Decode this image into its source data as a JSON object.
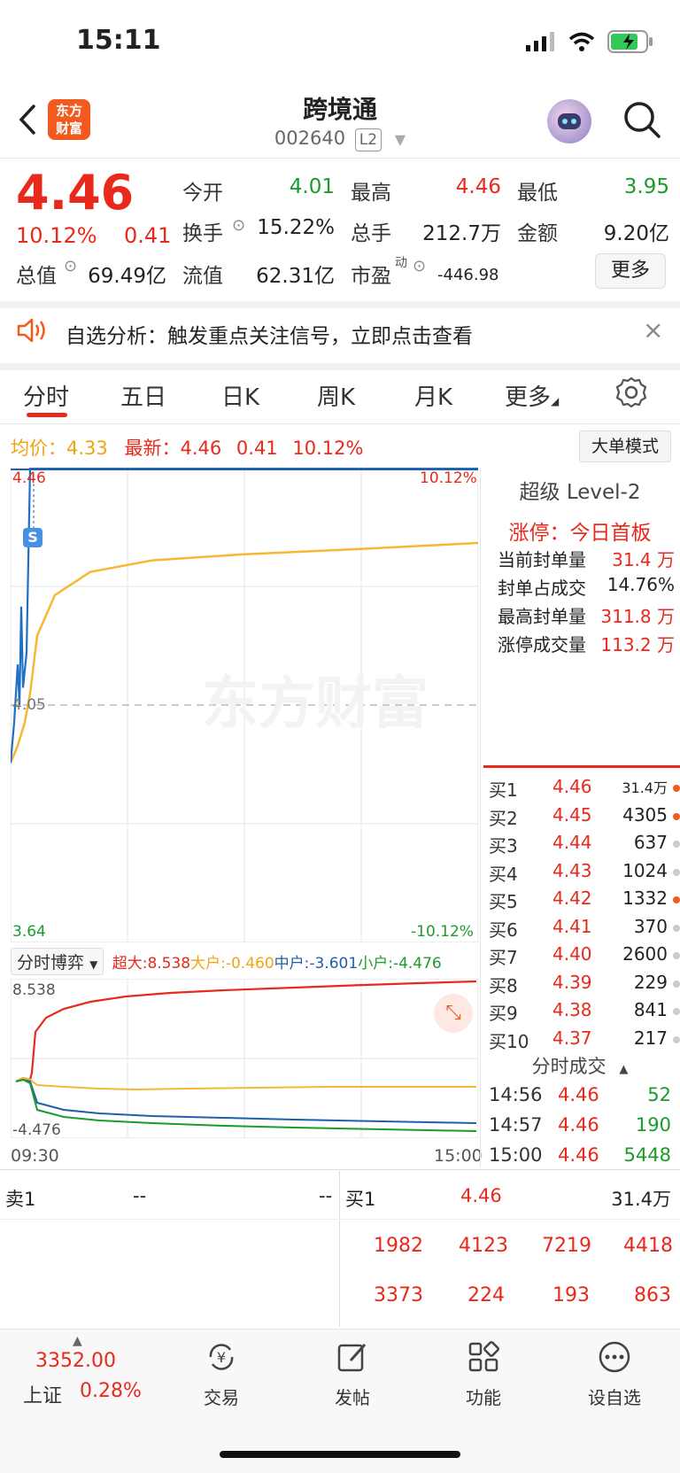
{
  "status_bar": {
    "time": "15:11"
  },
  "header": {
    "logo_text": "东方财富",
    "stock_name": "跨境通",
    "stock_code": "002640",
    "level_badge": "L2"
  },
  "quote": {
    "price": "4.46",
    "change_pct": "10.12%",
    "change": "0.41",
    "stats": [
      {
        "label": "今开",
        "value": "4.01",
        "color": "green"
      },
      {
        "label": "最高",
        "value": "4.46",
        "color": "red"
      },
      {
        "label": "最低",
        "value": "3.95",
        "color": "green"
      },
      {
        "label": "换手",
        "value": "15.22%",
        "color": "black"
      },
      {
        "label": "总手",
        "value": "212.7万",
        "color": "black"
      },
      {
        "label": "金额",
        "value": "9.20亿",
        "color": "black"
      },
      {
        "label": "总值",
        "value": "69.49亿",
        "color": "black"
      },
      {
        "label": "流值",
        "value": "62.31亿",
        "color": "black"
      },
      {
        "label": "市盈",
        "value": "-446.98",
        "color": "black"
      }
    ],
    "pe_sup": "动",
    "more_label": "更多"
  },
  "alert": {
    "text": "自选分析：触发重点关注信号，立即点击查看",
    "close": "×"
  },
  "tabs": [
    "分时",
    "五日",
    "日K",
    "周K",
    "月K",
    "更多"
  ],
  "chart_header": {
    "avg_label": "均价：",
    "avg_value": "4.33",
    "latest_label": "最新：",
    "latest_value": "4.46",
    "latest_change": "0.41",
    "latest_pct": "10.12%",
    "big_order_mode": "大单模式"
  },
  "chart_data": {
    "type": "line",
    "y_labels": {
      "top": "4.46",
      "mid": "4.05",
      "bottom": "3.64",
      "top_pct": "10.12%",
      "bottom_pct": "-10.12%"
    },
    "ylim": [
      3.64,
      4.46
    ],
    "price_series": [
      3.95,
      4.02,
      4.12,
      4.05,
      4.22,
      4.08,
      4.14,
      4.46,
      4.46,
      4.46
    ],
    "avg_series": [
      3.95,
      3.98,
      4.02,
      4.07,
      4.17,
      4.24,
      4.28,
      4.3,
      4.31,
      4.32,
      4.33
    ],
    "flow": {
      "selector": "分时博弈",
      "series": [
        {
          "name": "超大",
          "value": "8.538",
          "color": "#e8291b"
        },
        {
          "name": "大户",
          "value": "-0.460",
          "color": "#f2a311"
        },
        {
          "name": "中户",
          "value": "-3.601",
          "color": "#1f5ea8"
        },
        {
          "name": "小户",
          "value": "-4.476",
          "color": "#1a9c2a"
        }
      ],
      "y_top": "8.538",
      "y_bottom": "-4.476"
    },
    "time_start": "09:30",
    "time_end": "15:00"
  },
  "level2": {
    "title": "超级 Level-2",
    "limit_title": "涨停：今日首板",
    "seal": [
      {
        "label": "当前封单量",
        "value": "31.4 万"
      },
      {
        "label": "封单占成交",
        "value": "14.76%"
      },
      {
        "label": "最高封单量",
        "value": "311.8 万"
      },
      {
        "label": "涨停成交量",
        "value": "113.2 万"
      }
    ],
    "bids": [
      {
        "label": "买1",
        "price": "4.46",
        "vol": "31.4万",
        "dot": "#f25a1f"
      },
      {
        "label": "买2",
        "price": "4.45",
        "vol": "4305",
        "dot": "#f25a1f"
      },
      {
        "label": "买3",
        "price": "4.44",
        "vol": "637",
        "dot": "#ccc"
      },
      {
        "label": "买4",
        "price": "4.43",
        "vol": "1024",
        "dot": "#ccc"
      },
      {
        "label": "买5",
        "price": "4.42",
        "vol": "1332",
        "dot": "#f25a1f"
      },
      {
        "label": "买6",
        "price": "4.41",
        "vol": "370",
        "dot": "#ccc"
      },
      {
        "label": "买7",
        "price": "4.40",
        "vol": "2600",
        "dot": "#ccc"
      },
      {
        "label": "买8",
        "price": "4.39",
        "vol": "229",
        "dot": "#ccc"
      },
      {
        "label": "买9",
        "price": "4.38",
        "vol": "841",
        "dot": "#ccc"
      },
      {
        "label": "买10",
        "price": "4.37",
        "vol": "217",
        "dot": "#ccc"
      }
    ],
    "trades_title": "分时成交",
    "trades": [
      {
        "time": "14:56",
        "price": "4.46",
        "vol": "52"
      },
      {
        "time": "14:57",
        "price": "4.46",
        "vol": "190"
      },
      {
        "time": "15:00",
        "price": "4.46",
        "vol": "5448"
      }
    ]
  },
  "strip": {
    "ask1": "卖1",
    "ask1_dash": "--",
    "bid1": "买1",
    "bid1_price": "4.46",
    "bid1_vol": "31.4万",
    "queue_row1": [
      "1982",
      "4123",
      "7219",
      "4418"
    ],
    "queue_row2": [
      "3373",
      "224",
      "193",
      "863"
    ]
  },
  "bottom_nav": {
    "index_value": "3352.00",
    "index_name": "上证",
    "index_pct": "0.28%",
    "items": [
      "交易",
      "发帖",
      "功能",
      "设自选"
    ]
  }
}
